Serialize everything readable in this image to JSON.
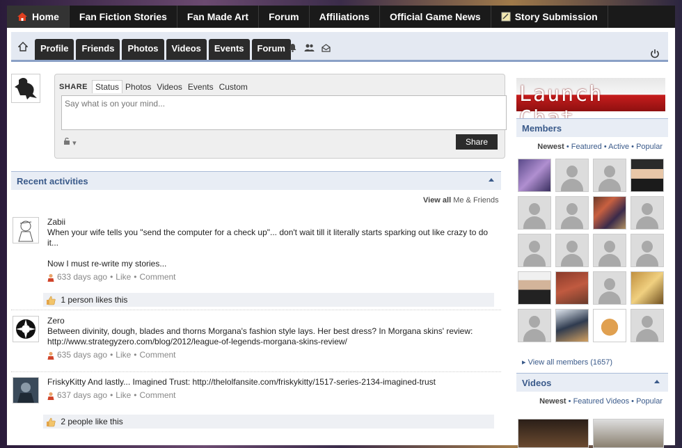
{
  "topnav": {
    "items": [
      "Home",
      "Fan Fiction Stories",
      "Fan Made Art",
      "Forum",
      "Affiliations",
      "Official Game News",
      "Story Submission"
    ]
  },
  "subnav": {
    "tabs": [
      "Profile",
      "Friends",
      "Photos",
      "Videos",
      "Events",
      "Forum"
    ]
  },
  "share": {
    "label": "SHARE",
    "tabs": [
      "Status",
      "Photos",
      "Videos",
      "Events",
      "Custom"
    ],
    "placeholder": "Say what is on your mind...",
    "button": "Share"
  },
  "recent": {
    "title": "Recent activities",
    "view_all": "View all",
    "view_all_suffix": "Me & Friends",
    "items": [
      {
        "name": "Zabii",
        "text": "When your wife tells you \"send the computer for a check up\"... don't wait till it literally starts sparking out like crazy to do it...",
        "text2": "Now I must re-write my stories...",
        "time": "633 days ago",
        "like": "Like",
        "comment": "Comment",
        "likes": "1 person likes this"
      },
      {
        "name": "Zero",
        "text": "Between divinity, dough, blades and thorns Morgana's fashion style lays. Her best dress? In Morgana skins' review: http://www.strategyzero.com/blog/2012/league-of-legends-morgana-skins-review/",
        "time": "635 days ago",
        "like": "Like",
        "comment": "Comment"
      },
      {
        "name": "FriskyKitty",
        "text": "And lastly... Imagined Trust: http://thelolfansite.com/friskykitty/1517-series-2134-imagined-trust",
        "time": "637 days ago",
        "like": "Like",
        "comment": "Comment",
        "likes": "2 people like this"
      }
    ]
  },
  "right": {
    "chat": "Launch Chat",
    "members_title": "Members",
    "members_filters": [
      "Newest",
      "Featured",
      "Active",
      "Popular"
    ],
    "view_all_members": "View all members (1657)",
    "videos_title": "Videos",
    "videos_filters": [
      "Newest",
      "Featured Videos",
      "Popular"
    ]
  },
  "colors": {
    "accent": "#3a5a8a",
    "dark": "#2b2b2b"
  }
}
